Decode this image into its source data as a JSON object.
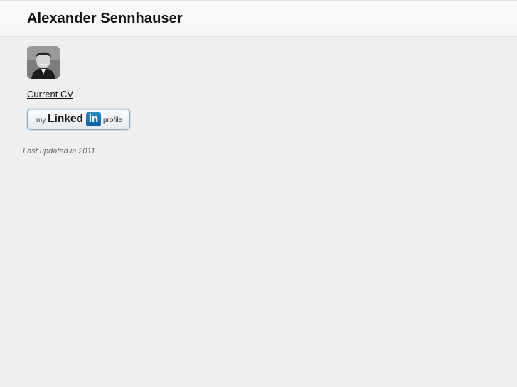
{
  "header": {
    "title": "Alexander Sennhauser"
  },
  "profile": {
    "avatar_icon": "person-portrait",
    "cv_link_label": "Current CV"
  },
  "linkedin_badge": {
    "my": "my",
    "linked": "Linked",
    "in": "in",
    "profile": "profile"
  },
  "footer": {
    "last_updated": "Last updated in 2011"
  },
  "colors": {
    "background": "#efefef",
    "header": "#f8f8f8",
    "linkedin_blue": "#0a66a8"
  }
}
